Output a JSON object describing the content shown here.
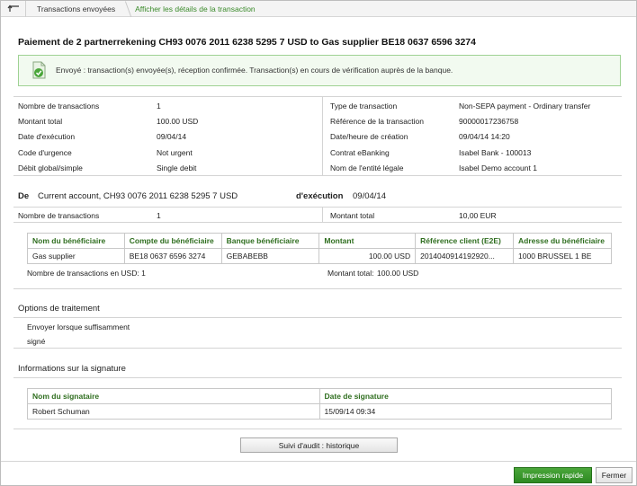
{
  "breadcrumb": {
    "items": [
      {
        "label": "Transactions envoyées"
      },
      {
        "label": "Afficher les détails de la transaction"
      }
    ]
  },
  "page_title": "Paiement de 2 partnerrekening CH93 0076 2011 6238 5295 7 USD to Gas supplier BE18 0637 6596 3274",
  "alert": {
    "text": "Envoyé : transaction(s) envoyée(s), réception confirmée. Transaction(s) en cours de vérification auprès de la banque."
  },
  "summary": {
    "left": [
      {
        "label": "Nombre de transactions",
        "value": "1"
      },
      {
        "label": "Montant total",
        "value": "100.00 USD"
      },
      {
        "label": "Date d'exécution",
        "value": "09/04/14"
      },
      {
        "label": "Code d'urgence",
        "value": "Not urgent"
      },
      {
        "label": "Débit global/simple",
        "value": "Single debit"
      }
    ],
    "right": [
      {
        "label": "Type de transaction",
        "value": "Non-SEPA payment - Ordinary transfer"
      },
      {
        "label": "Référence de la transaction",
        "value": "90000017236758"
      },
      {
        "label": "Date/heure de création",
        "value": "09/04/14 14:20"
      },
      {
        "label": "Contrat eBanking",
        "value": "Isabel Bank - 100013"
      },
      {
        "label": "Nom de l'entité légale",
        "value": "Isabel Demo account 1"
      }
    ]
  },
  "debit": {
    "de_label": "De",
    "account": "Current account, CH93 0076 2011 6238 5295 7 USD",
    "exec_label": "d'exécution",
    "exec_date": "09/04/14",
    "count_label": "Nombre de transactions",
    "count_value": "1",
    "total_label": "Montant total",
    "total_value": "10,00 EUR"
  },
  "beneficiaries": {
    "columns": [
      "Nom du bénéficiaire",
      "Compte du bénéficiaire",
      "Banque bénéficiaire",
      "Montant",
      "Référence client (E2E)",
      "Adresse du bénéficiaire"
    ],
    "rows": [
      [
        "Gas supplier",
        "BE18 0637 6596 3274",
        "GEBABEBB",
        "100.00 USD",
        "2014040914192920...",
        "1000 BRUSSEL 1 BE"
      ]
    ],
    "footer_count": "Nombre de transactions en USD: 1",
    "footer_total_label": "Montant total:",
    "footer_total_value": "100.00 USD"
  },
  "processing": {
    "title": "Options de traitement",
    "line1": "Envoyer lorsque suffisamment",
    "line2": "signé"
  },
  "signature": {
    "title": "Informations sur la signature",
    "columns": [
      "Nom du signataire",
      "Date de signature"
    ],
    "rows": [
      [
        "Robert Schuman",
        "15/09/14 09:34"
      ]
    ]
  },
  "buttons": {
    "audit": "Suivi d'audit : historique",
    "print": "Impression rapide",
    "close": "Fermer"
  },
  "colors": {
    "accent_green": "#3a8a2a",
    "header_green": "#2f6e1f",
    "alert_bg": "#f2faf0",
    "alert_border": "#9fd294"
  },
  "icons": {
    "back": "back-arrow-icon",
    "success": "document-check-icon"
  }
}
